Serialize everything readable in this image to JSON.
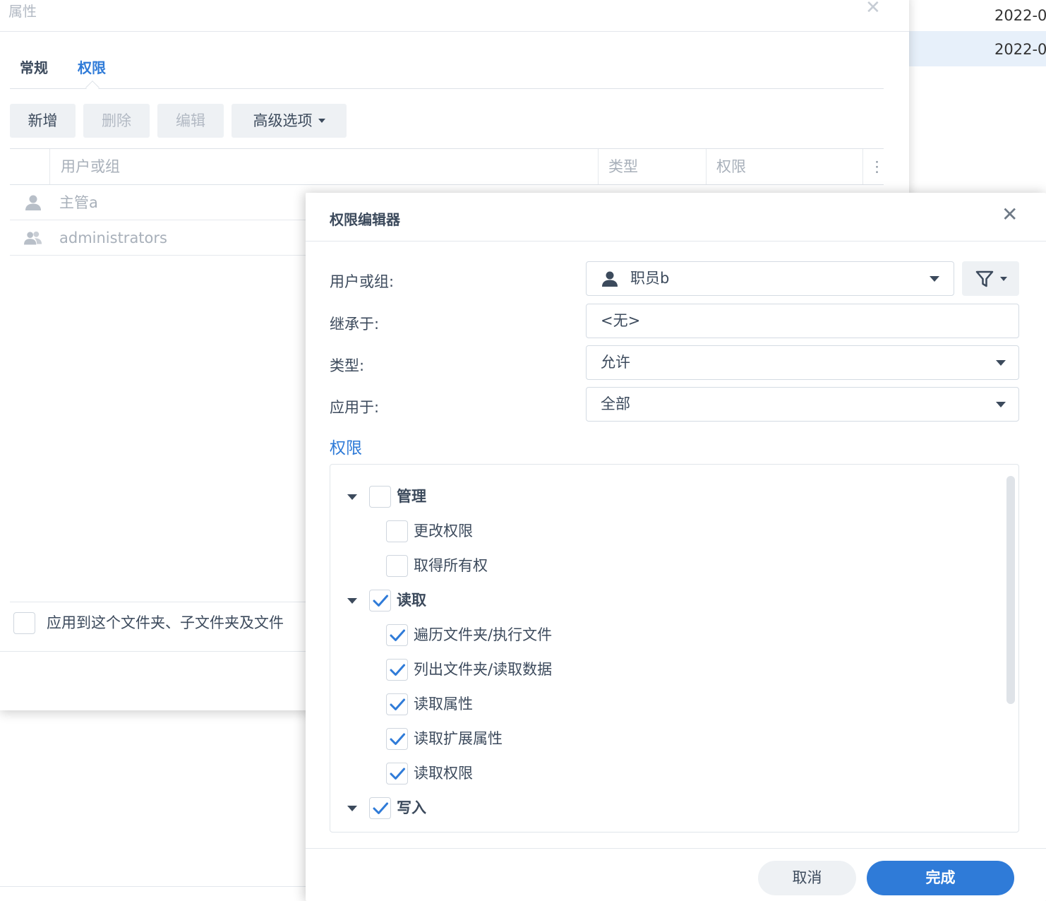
{
  "background_list": {
    "rows": [
      {
        "text": "2022-0"
      },
      {
        "text": "2022-0"
      }
    ]
  },
  "properties": {
    "title": "属性",
    "tabs": [
      {
        "label": "常规"
      },
      {
        "label": "权限"
      }
    ],
    "toolbar": {
      "new_label": "新增",
      "delete_label": "删除",
      "edit_label": "编辑",
      "advanced_label": "高级选项"
    },
    "table": {
      "columns": [
        "用户或组",
        "类型",
        "权限"
      ],
      "rows": [
        {
          "name": "主管a",
          "icon": "user-icon"
        },
        {
          "name": "administrators",
          "icon": "group-icon"
        }
      ]
    },
    "apply_label": "应用到这个文件夹、子文件夹及文件"
  },
  "editor": {
    "title": "权限编辑器",
    "fields": {
      "user_label": "用户或组:",
      "user_value": "职员b",
      "inherit_label": "继承于:",
      "inherit_value": "<无>",
      "type_label": "类型:",
      "type_value": "允许",
      "apply_label": "应用于:",
      "apply_value": "全部"
    },
    "perm_heading": "权限",
    "permissions": [
      {
        "label": "管理",
        "checked": false,
        "group": true
      },
      {
        "label": "更改权限",
        "checked": false,
        "group": false
      },
      {
        "label": "取得所有权",
        "checked": false,
        "group": false
      },
      {
        "label": "读取",
        "checked": true,
        "group": true
      },
      {
        "label": "遍历文件夹/执行文件",
        "checked": true,
        "group": false
      },
      {
        "label": "列出文件夹/读取数据",
        "checked": true,
        "group": false
      },
      {
        "label": "读取属性",
        "checked": true,
        "group": false
      },
      {
        "label": "读取扩展属性",
        "checked": true,
        "group": false
      },
      {
        "label": "读取权限",
        "checked": true,
        "group": false
      },
      {
        "label": "写入",
        "checked": true,
        "group": true
      }
    ],
    "cancel_label": "取消",
    "done_label": "完成"
  },
  "colors": {
    "accent": "#2f7bd8",
    "text": "#3c4a5c",
    "muted": "#a8b0ba",
    "button_bg": "#eef1f4"
  }
}
